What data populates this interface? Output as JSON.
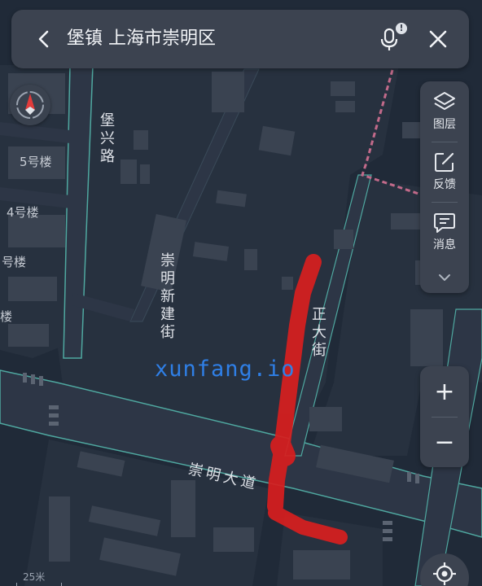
{
  "search": {
    "title": "堡镇 上海市崇明区",
    "back_icon": "chevron-left-icon",
    "mic_icon": "microphone-icon",
    "mic_badge": "!",
    "close_icon": "close-icon"
  },
  "compass": {
    "icon": "compass-icon"
  },
  "toolbar": {
    "items": [
      {
        "label": "图层",
        "icon": "layers-icon"
      },
      {
        "label": "反馈",
        "icon": "edit-feedback-icon"
      },
      {
        "label": "消息",
        "icon": "message-icon"
      }
    ],
    "more_icon": "chevron-down-icon"
  },
  "zoom": {
    "in_label": "+",
    "out_label": "−"
  },
  "locate": {
    "icon": "locate-icon"
  },
  "scale": {
    "label": "25米"
  },
  "watermark": "xunfang.io",
  "map": {
    "roads": {
      "baoxing": "堡兴路",
      "chongming_xinjian": "崇明新建街",
      "zhengda": "正大街",
      "chongming_dadao": "崇明大道"
    },
    "buildings": [
      "5号楼",
      "4号楼",
      "号楼",
      "楼"
    ],
    "colors": {
      "background": "#202a38",
      "block": "#27313f",
      "road": "#2d3646",
      "road_edge": "#4fa8a0",
      "building": "#3a4351",
      "route": "#d81e1e",
      "panel": "#3c4350"
    }
  }
}
